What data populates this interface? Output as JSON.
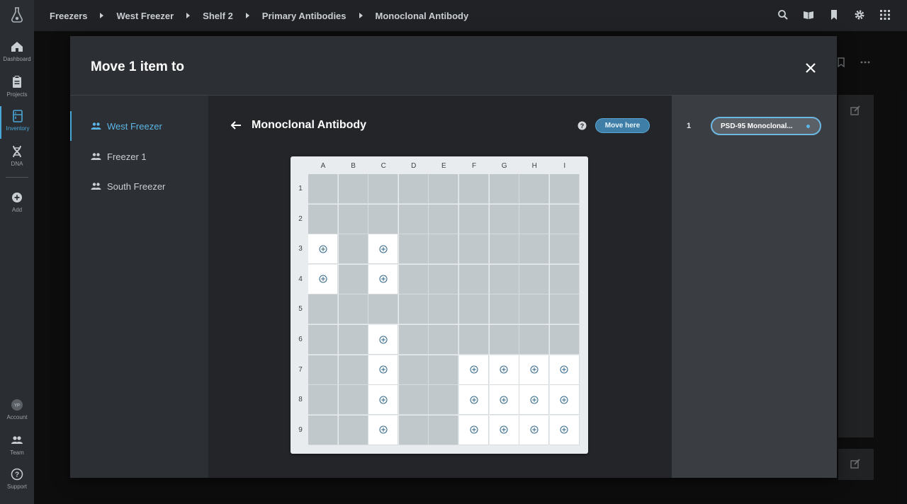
{
  "nav": {
    "items": [
      {
        "label": "Dashboard",
        "icon": "home-icon"
      },
      {
        "label": "Projects",
        "icon": "clipboard-icon"
      },
      {
        "label": "Inventory",
        "icon": "freezer-icon"
      },
      {
        "label": "DNA",
        "icon": "dna-icon"
      },
      {
        "label": "Add",
        "icon": "plus-circle-icon"
      }
    ],
    "bottom": [
      {
        "label": "Account",
        "icon": "avatar-icon"
      },
      {
        "label": "Team",
        "icon": "team-icon"
      },
      {
        "label": "Support",
        "icon": "help-circle-icon"
      }
    ],
    "avatar_initials": "YP"
  },
  "breadcrumb": [
    "Freezers",
    "West Freezer",
    "Shelf 2",
    "Primary Antibodies",
    "Monoclonal Antibody"
  ],
  "modal": {
    "title": "Move 1 item to",
    "locations": [
      "West Freezer",
      "Freezer 1",
      "South Freezer"
    ],
    "selected_location": "West Freezer",
    "current_box": "Monoclonal Antibody",
    "move_button": "Move here",
    "grid": {
      "columns": [
        "A",
        "B",
        "C",
        "D",
        "E",
        "F",
        "G",
        "H",
        "I"
      ],
      "rows": [
        "1",
        "2",
        "3",
        "4",
        "5",
        "6",
        "7",
        "8",
        "9"
      ],
      "available": [
        "A3",
        "C3",
        "A4",
        "C4",
        "C6",
        "C7",
        "F7",
        "G7",
        "H7",
        "I7",
        "C8",
        "F8",
        "G8",
        "H8",
        "I8",
        "C9",
        "F9",
        "G9",
        "H9",
        "I9"
      ]
    },
    "items": [
      {
        "index": "1",
        "name": "PSD-95 Monoclonal..."
      }
    ]
  },
  "colors": {
    "accent": "#4aa8d8",
    "button": "#3f7ea6",
    "occupied": "#c1c8cc",
    "available": "#ffffff"
  }
}
